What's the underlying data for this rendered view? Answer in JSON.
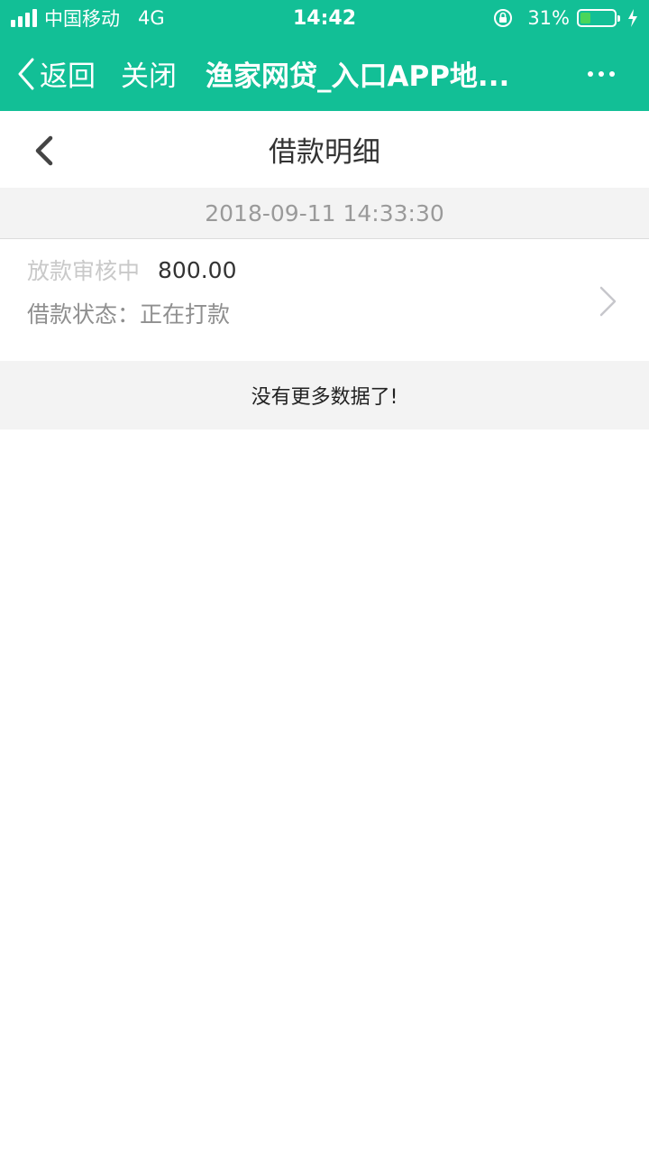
{
  "status_bar": {
    "carrier": "中国移动",
    "network": "4G",
    "time": "14:42",
    "battery_percent_text": "31%",
    "battery_level": 0.31
  },
  "nav": {
    "back_label": "返回",
    "close_label": "关闭",
    "title": "渔家网贷_入口APP地..."
  },
  "page": {
    "title": "借款明细"
  },
  "records": [
    {
      "datetime": "2018-09-11 14:33:30",
      "status": "放款审核中",
      "amount": "800.00",
      "state_label": "借款状态：",
      "state_value": "正在打款"
    }
  ],
  "footer": {
    "no_more": "没有更多数据了!"
  },
  "colors": {
    "brand": "#12bf96",
    "battery_fill": "#4ad65a"
  },
  "icons": [
    "signal-icon",
    "orientation-lock-icon",
    "battery-icon",
    "charging-icon",
    "back-chevron-icon",
    "more-icon",
    "chevron-right-icon"
  ]
}
